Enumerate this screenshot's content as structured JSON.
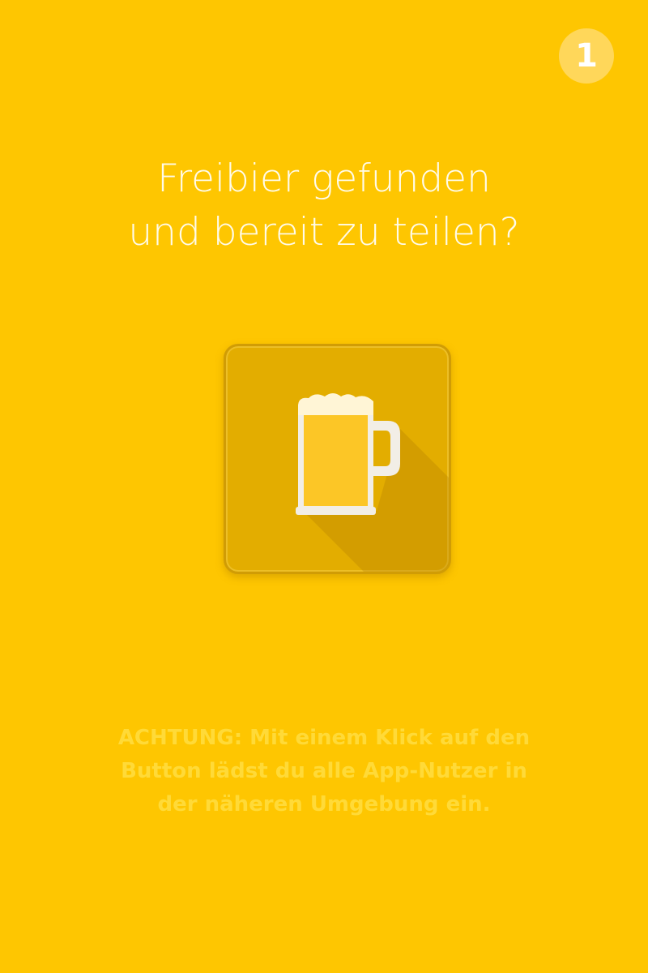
{
  "step_badge": {
    "label": "1"
  },
  "headline": {
    "line1": "Freibier gefunden",
    "line2": "und bereit zu teilen?"
  },
  "share_button": {
    "icon": "beer-mug-icon"
  },
  "warning": {
    "line1": "ACHTUNG: Mit einem Klick auf den",
    "line2": "Button lädst du alle App-Nutzer in",
    "line3": "der näheren Umgebung ein."
  },
  "colors": {
    "background": "#FEC601",
    "button": "#E3AD00",
    "beer": "#FCC626",
    "foam": "#FFF5D6",
    "mug": "#F2EEE6"
  }
}
